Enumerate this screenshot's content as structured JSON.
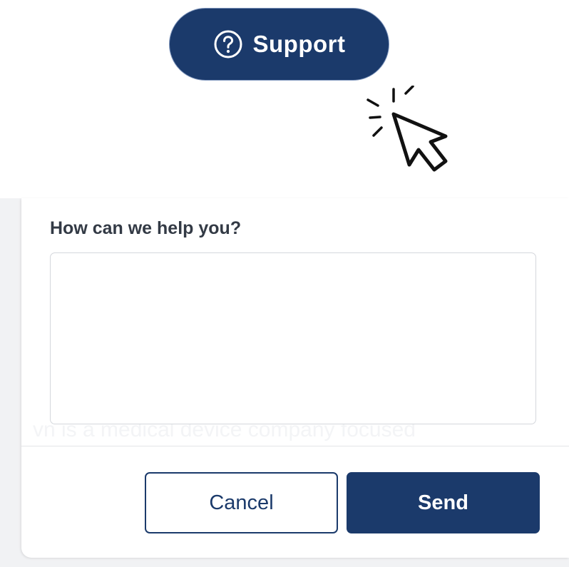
{
  "support_button": {
    "label": "Support",
    "icon": "question-circle-icon"
  },
  "cursor": {
    "icon": "click-pointer-icon"
  },
  "dialog": {
    "heading": "How can we help you?",
    "message": {
      "value": "",
      "placeholder": ""
    },
    "background_text": "vn is a medical device company focused",
    "cancel_label": "Cancel",
    "send_label": "Send"
  },
  "colors": {
    "brand_navy": "#1b3a6b",
    "heading_text": "#333a45",
    "input_border": "#d4d7dc",
    "backdrop": "#f1f2f4"
  }
}
